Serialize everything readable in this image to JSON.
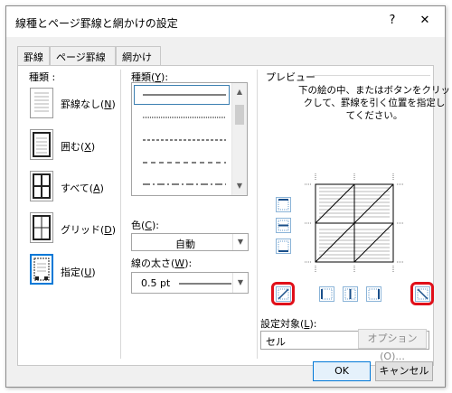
{
  "window": {
    "title": "線種とページ罫線と網かけの設定",
    "help": "?",
    "close": "✕"
  },
  "tabs": [
    "罫線",
    "ページ罫線",
    "網かけ"
  ],
  "settings": {
    "heading": "種類 :",
    "items": [
      {
        "label": "罫線なし(",
        "key": "N",
        "tail": ")"
      },
      {
        "label": "囲む(",
        "key": "X",
        "tail": ")"
      },
      {
        "label": "すべて(",
        "key": "A",
        "tail": ")"
      },
      {
        "label": "グリッド(",
        "key": "D",
        "tail": ")"
      },
      {
        "label": "指定(",
        "key": "U",
        "tail": ")"
      }
    ]
  },
  "line_style": {
    "heading_pre": "種類(",
    "heading_key": "Y",
    "heading_post": "):",
    "styles": [
      "solid",
      "dotted",
      "small-dash",
      "dash",
      "dash-dot"
    ]
  },
  "color": {
    "label_pre": "色(",
    "label_key": "C",
    "label_post": "):",
    "value": "自動"
  },
  "width": {
    "label_pre": "線の太さ(",
    "label_key": "W",
    "label_post": "):",
    "value": "0.5 pt"
  },
  "preview": {
    "heading": "プレビュー",
    "instruction_lines": [
      "下の絵の中、またはボタンをクリッ",
      "クして、罫線を引く位置を指定し",
      "てください。"
    ]
  },
  "apply_to": {
    "label_pre": "設定対象(",
    "label_key": "L",
    "label_post": "):",
    "value": "セル"
  },
  "buttons": {
    "options": "オプション(O)...",
    "ok": "OK",
    "cancel": "キャンセル"
  },
  "colors": {
    "highlight_red": "#e0101a",
    "accent_blue": "#0078d7"
  }
}
